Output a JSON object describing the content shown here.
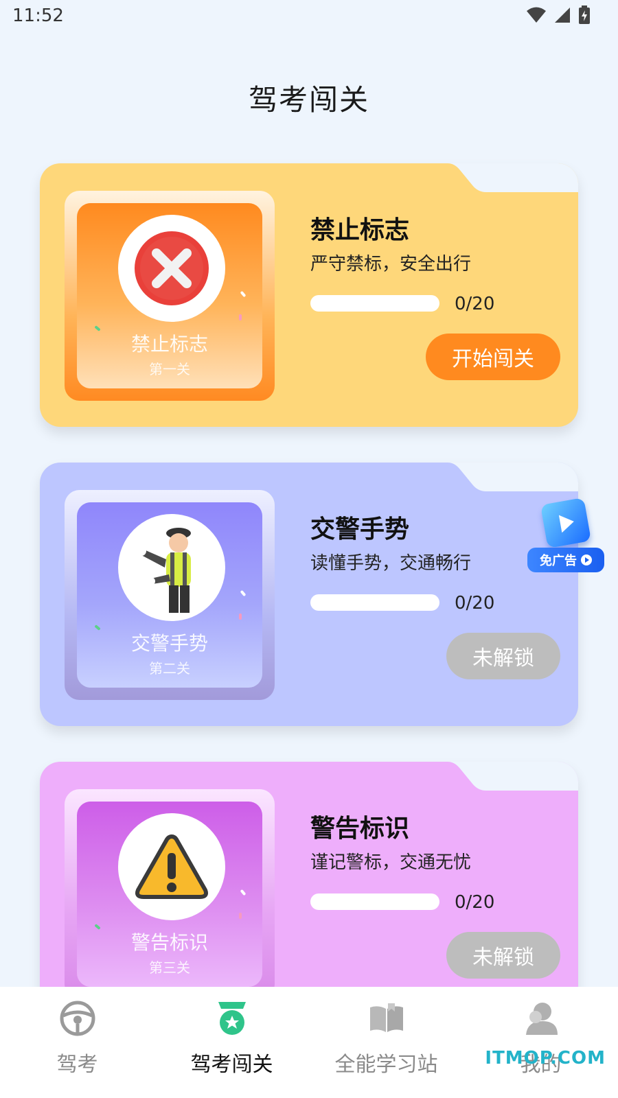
{
  "status_bar": {
    "time": "11:52"
  },
  "page": {
    "title": "驾考闯关"
  },
  "levels": [
    {
      "title": "禁止标志",
      "subtitle": "严守禁标，安全出行",
      "thumb_name": "禁止标志",
      "thumb_level": "第一关",
      "progress_text": "0/20",
      "progress_fraction": 0,
      "button": "开始闯关",
      "locked": false,
      "icon": "no-entry-icon",
      "colors": {
        "card": "#fed77a",
        "tab": "#ffa813",
        "button": "#ff8a1f"
      }
    },
    {
      "title": "交警手势",
      "subtitle": "读懂手势，交通畅行",
      "thumb_name": "交警手势",
      "thumb_level": "第二关",
      "progress_text": "0/20",
      "progress_fraction": 0,
      "button": "未解锁",
      "locked": true,
      "icon": "traffic-police-icon",
      "colors": {
        "card": "#bdc6ff",
        "tab": "#9a8cf8",
        "button": "#bdbdbd"
      }
    },
    {
      "title": "警告标识",
      "subtitle": "谨记警标，交通无忧",
      "thumb_name": "警告标识",
      "thumb_level": "第三关",
      "progress_text": "0/20",
      "progress_fraction": 0,
      "button": "未解锁",
      "locked": true,
      "icon": "warning-triangle-icon",
      "colors": {
        "card": "#eeaefb",
        "tab": "#cf62e6",
        "button": "#bdbdbd"
      }
    }
  ],
  "ad_badge": {
    "label": "免广告",
    "icon": "video-cube-icon"
  },
  "tabbar": {
    "items": [
      {
        "label": "驾考",
        "icon": "steering-wheel-icon",
        "active": false
      },
      {
        "label": "驾考闯关",
        "icon": "medal-icon",
        "active": true
      },
      {
        "label": "全能学习站",
        "icon": "open-book-icon",
        "active": false
      },
      {
        "label": "我的",
        "icon": "user-icon",
        "active": false
      }
    ]
  },
  "watermark": "ITMOP.COM",
  "accent": "#2fc48a"
}
